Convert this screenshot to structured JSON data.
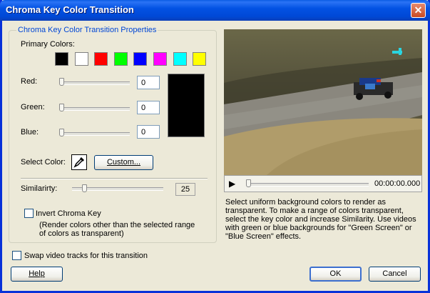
{
  "window": {
    "title": "Chroma Key Color Transition"
  },
  "group": {
    "label": "Chroma Key Color Transition Properties"
  },
  "primary_colors": {
    "label": "Primary Colors:",
    "swatches": [
      "#000000",
      "#ffffff",
      "#ff0000",
      "#00ff00",
      "#0000ff",
      "#ff00ff",
      "#00ffff",
      "#ffff00"
    ]
  },
  "red": {
    "label": "Red:",
    "value": "0"
  },
  "green": {
    "label": "Green:",
    "value": "0"
  },
  "blue": {
    "label": "Blue:",
    "value": "0"
  },
  "select_color": {
    "label": "Select Color:",
    "custom_button": "Custom..."
  },
  "similarity": {
    "label": "Similarirty:",
    "value": "25"
  },
  "invert": {
    "label": "Invert Chroma Key",
    "note": "(Render colors other than the selected range of colors as transparent)"
  },
  "swap": {
    "label": "Swap video tracks for this transition"
  },
  "player": {
    "time": "00:00:00.000"
  },
  "description": "Select uniform background colors to render as transparent. To make a range of colors transparent, select the key color and increase Similarity. Use videos with green or blue backgrounds for \"Green Screen\" or \"Blue Screen\" effects.",
  "buttons": {
    "help": "Help",
    "ok": "OK",
    "cancel": "Cancel"
  }
}
